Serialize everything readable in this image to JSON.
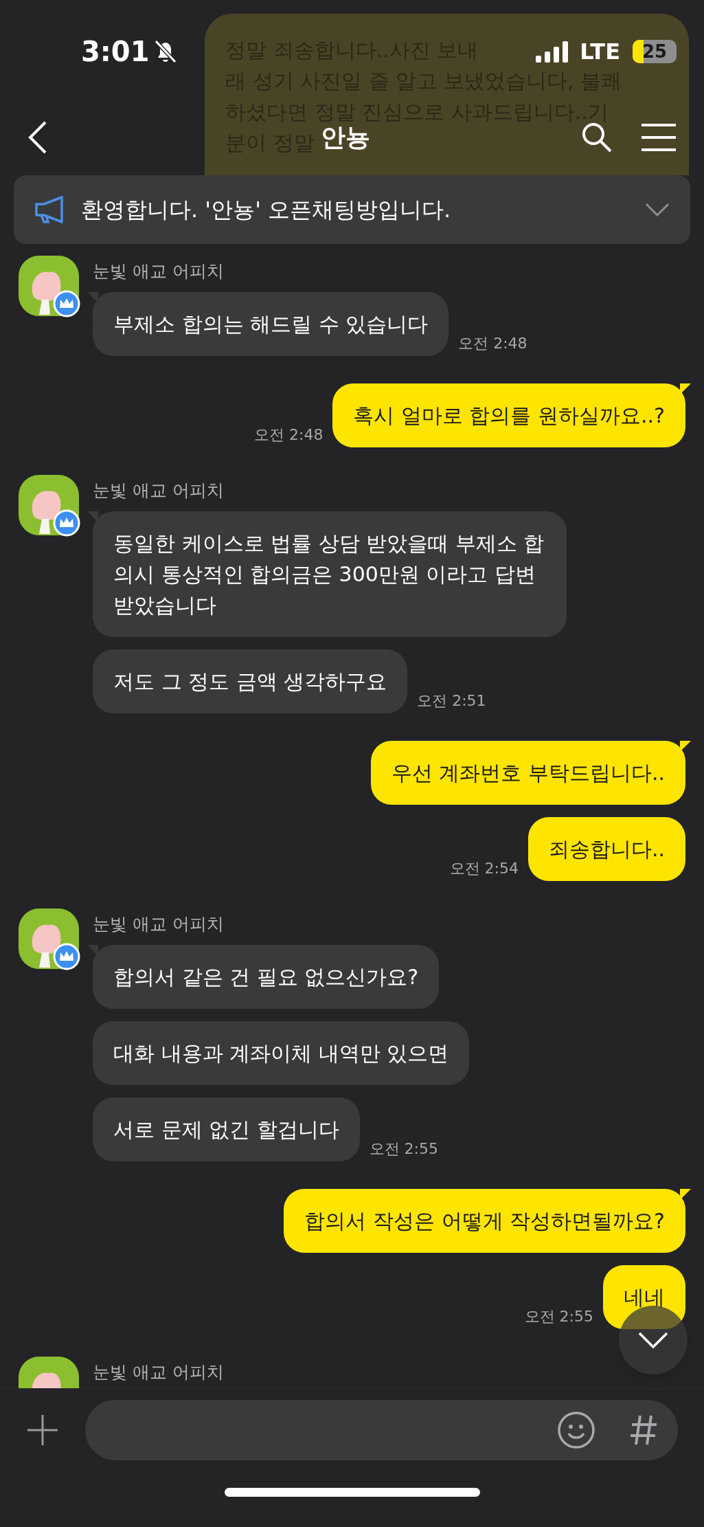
{
  "status_bar": {
    "time": "3:01",
    "network": "LTE",
    "battery": "25"
  },
  "ghost_message": {
    "lines": [
      "정말 죄송합니다..사진 보내",
      "래 성기 사진일 줄 알고 보냈었습니다, 불쾌",
      "하셨다면 정말 진심으로 사과드립니다..기",
      "분이 정말"
    ]
  },
  "header": {
    "title": "안뇽"
  },
  "notice": {
    "text": "환영합니다. '안뇽' 오픈채팅방입니다.",
    "expanded": false
  },
  "messages": [
    {
      "kind": "received",
      "sender": "눈빛 애교 어피치",
      "bubbles": [
        "부제소 합의는 해드릴 수 있습니다"
      ],
      "time": "오전 2:48"
    },
    {
      "kind": "sent",
      "bubbles": [
        "혹시 얼마로 합의를 원하실까요..?"
      ],
      "time": "오전 2:48"
    },
    {
      "kind": "received",
      "sender": "눈빛 애교 어피치",
      "bubbles": [
        "동일한 케이스로 법률 상담 받았을때 부제소 합의시 통상적인 합의금은 300만원 이라고 답변 받았습니다",
        "저도 그 정도 금액 생각하구요"
      ],
      "time": "오전 2:51"
    },
    {
      "kind": "sent",
      "bubbles": [
        "우선 계좌번호 부탁드립니다..",
        "죄송합니다.."
      ],
      "time": "오전 2:54"
    },
    {
      "kind": "received",
      "sender": "눈빛 애교 어피치",
      "bubbles": [
        "합의서 같은 건 필요 없으신가요?",
        "대화 내용과 계좌이체 내역만 있으면",
        "서로 문제 없긴 할겁니다"
      ],
      "time": "오전 2:55"
    },
    {
      "kind": "sent",
      "bubbles": [
        "합의서 작성은 어떻게 작성하면될까요?",
        "네네"
      ],
      "time": "오전 2:55"
    },
    {
      "kind": "received",
      "sender": "눈빛 애교 어피치"
    }
  ]
}
